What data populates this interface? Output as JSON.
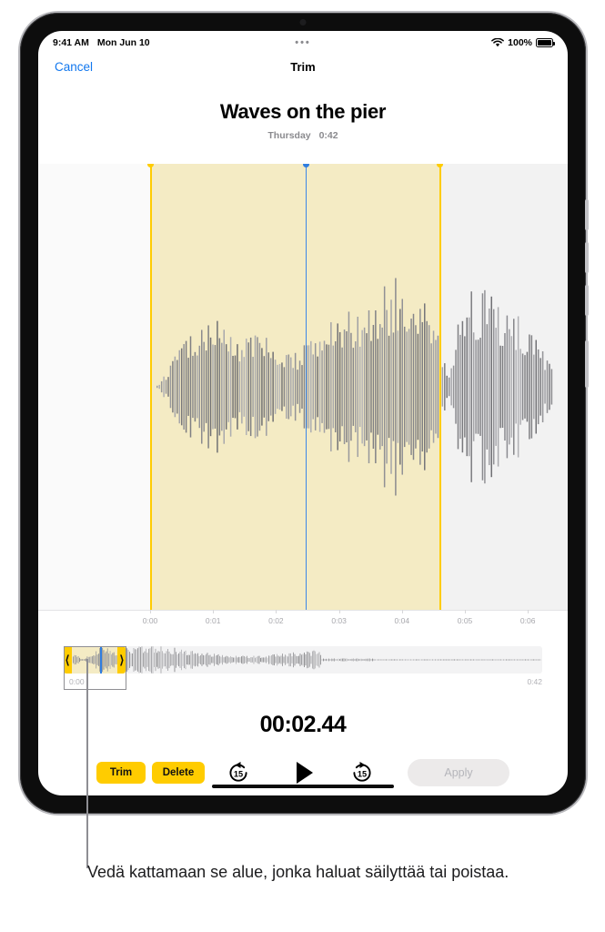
{
  "status_bar": {
    "time": "9:41 AM",
    "date": "Mon Jun 10",
    "dots": "•••",
    "battery_percent": "100%",
    "wifi_icon": "wifi-icon",
    "battery_icon": "battery-icon"
  },
  "nav": {
    "cancel_label": "Cancel",
    "title": "Trim"
  },
  "recording": {
    "title": "Waves on the pier",
    "day": "Thursday",
    "duration": "0:42"
  },
  "ruler": {
    "labels": [
      "0:00",
      "0:01",
      "0:02",
      "0:03",
      "0:04",
      "0:05",
      "0:06"
    ]
  },
  "scrubber": {
    "start_time": "0:00",
    "end_time": "0:42",
    "left_handle_icon": "handle-left-bracket-icon",
    "right_handle_icon": "handle-right-bracket-icon"
  },
  "playback": {
    "current_time": "00:02.44"
  },
  "controls": {
    "trim_label": "Trim",
    "delete_label": "Delete",
    "skip_back_label": "15",
    "skip_forward_label": "15",
    "play_icon": "play-icon",
    "apply_label": "Apply"
  },
  "annotation": {
    "caption": "Vedä kattamaan se alue, jonka haluat säilyttää tai poistaa."
  },
  "colors": {
    "accent_yellow": "#ffcc00",
    "selection_fill": "#f4ebc4",
    "playhead_blue": "#2f7de0",
    "link_blue": "#1177ee",
    "waveform_gray": "#8a8a8e"
  },
  "chart_data": {
    "type": "area",
    "title": "Audio waveform",
    "selection_start": "0:00",
    "selection_end": "0:04.6",
    "playhead_at": "00:02.44"
  }
}
